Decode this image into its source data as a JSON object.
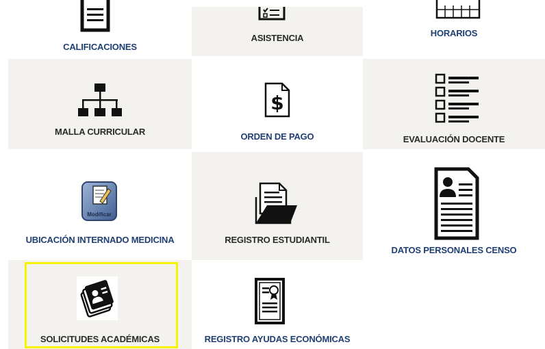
{
  "colors": {
    "tile_gray": "#f4f2ee",
    "tile_white": "#ffffff",
    "label_dark": "#2a2a2a",
    "label_blue": "#1f3f73",
    "highlight": "#f7f400"
  },
  "tiles": [
    {
      "label": "CALIFICACIONES",
      "icon": "document-list-icon"
    },
    {
      "label": "ASISTENCIA",
      "icon": "checklist-clipboard-icon"
    },
    {
      "label": "HORARIOS",
      "icon": "schedule-grid-icon"
    },
    {
      "label": "MALLA CURRICULAR",
      "icon": "org-chart-icon"
    },
    {
      "label": "ORDEN DE PAGO",
      "icon": "dollar-document-icon"
    },
    {
      "label": "EVALUACIÓN DOCENTE",
      "icon": "checkbox-list-icon"
    },
    {
      "label": "UBICACIÓN INTERNADO MEDICINA",
      "icon": "modify-edit-icon",
      "icon_text": "Modificar"
    },
    {
      "label": "REGISTRO ESTUDIANTIL",
      "icon": "folder-documents-icon"
    },
    {
      "label": "DATOS PERSONALES CENSO",
      "icon": "personal-record-icon"
    },
    {
      "label": "SOLICITUDES ACADÉMICAS",
      "icon": "id-cards-stack-icon",
      "selected": true
    },
    {
      "label": "REGISTRO AYUDAS ECONÓMICAS",
      "icon": "certificate-icon"
    }
  ]
}
